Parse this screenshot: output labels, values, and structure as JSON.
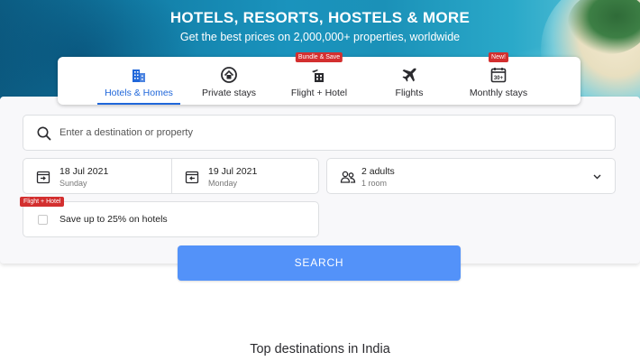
{
  "hero": {
    "title": "HOTELS, RESORTS, HOSTELS & MORE",
    "subtitle": "Get the best prices on 2,000,000+ properties, worldwide"
  },
  "tabs": [
    {
      "label": "Hotels & Homes",
      "icon": "building-icon",
      "active": true,
      "badge": ""
    },
    {
      "label": "Private stays",
      "icon": "house-icon",
      "active": false,
      "badge": ""
    },
    {
      "label": "Flight + Hotel",
      "icon": "flight-hotel-icon",
      "active": false,
      "badge": "Bundle & Save"
    },
    {
      "label": "Flights",
      "icon": "airplane-icon",
      "active": false,
      "badge": ""
    },
    {
      "label": "Monthly stays",
      "icon": "calendar-30-icon",
      "active": false,
      "badge": "New!"
    }
  ],
  "calendar_icon_text": "30+",
  "search": {
    "placeholder": "Enter a destination or property",
    "checkin": {
      "date": "18 Jul 2021",
      "day": "Sunday"
    },
    "checkout": {
      "date": "19 Jul 2021",
      "day": "Monday"
    },
    "guests": {
      "main": "2 adults",
      "sub": "1 room"
    },
    "bundle_ribbon": "Flight + Hotel",
    "bundle_label": "Save up to 25% on hotels",
    "button_label": "SEARCH"
  },
  "section_title": "Top destinations in India",
  "colors": {
    "accent": "#2067da",
    "search_button": "#5392f9",
    "badge_red": "#d32f2f"
  }
}
